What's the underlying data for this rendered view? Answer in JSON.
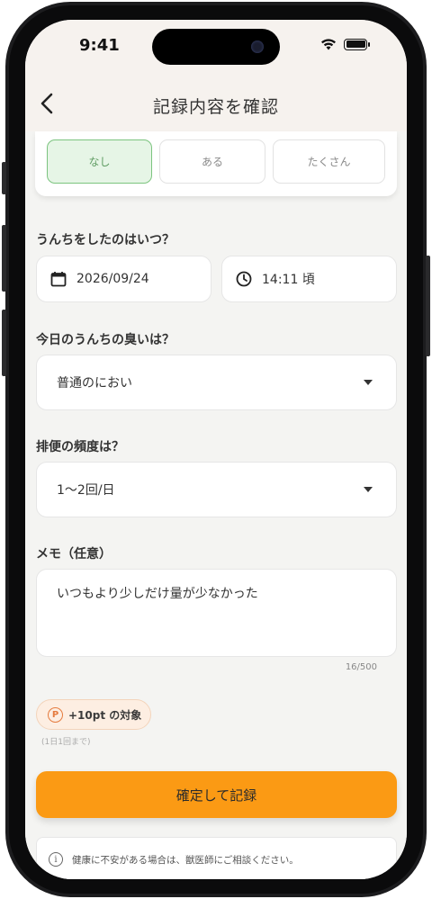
{
  "status_bar": {
    "time": "9:41"
  },
  "header": {
    "title": "記録内容を確認"
  },
  "amount_options": [
    {
      "label": "なし",
      "selected": true
    },
    {
      "label": "ある",
      "selected": false
    },
    {
      "label": "たくさん",
      "selected": false
    }
  ],
  "datetime_section": {
    "label": "うんちをしたのはいつ？",
    "date": "2026/09/24",
    "time": "14:11 頃"
  },
  "smell_section": {
    "label": "今日のうんちの臭いは？",
    "selected": "普通のにおい"
  },
  "frequency_section": {
    "label": "排便の頻度は？",
    "selected": "1〜2回/日"
  },
  "memo_section": {
    "label": "メモ（任意）",
    "value": "いつもより少しだけ量が少なかった",
    "counter": "16/500"
  },
  "points": {
    "icon_letter": "P",
    "badge": "+10pt の対象",
    "note": "(1日1回まで)"
  },
  "confirm_button": {
    "label": "確定して記録"
  },
  "notice": {
    "icon_letter": "i",
    "text": "健康に不安がある場合は、獣医師にご相談ください。"
  },
  "colors": {
    "accent": "#fb9a14",
    "selected_bg": "#e6f5e6",
    "selected_border": "#7cc47f",
    "points_bg": "#fdeee2"
  }
}
